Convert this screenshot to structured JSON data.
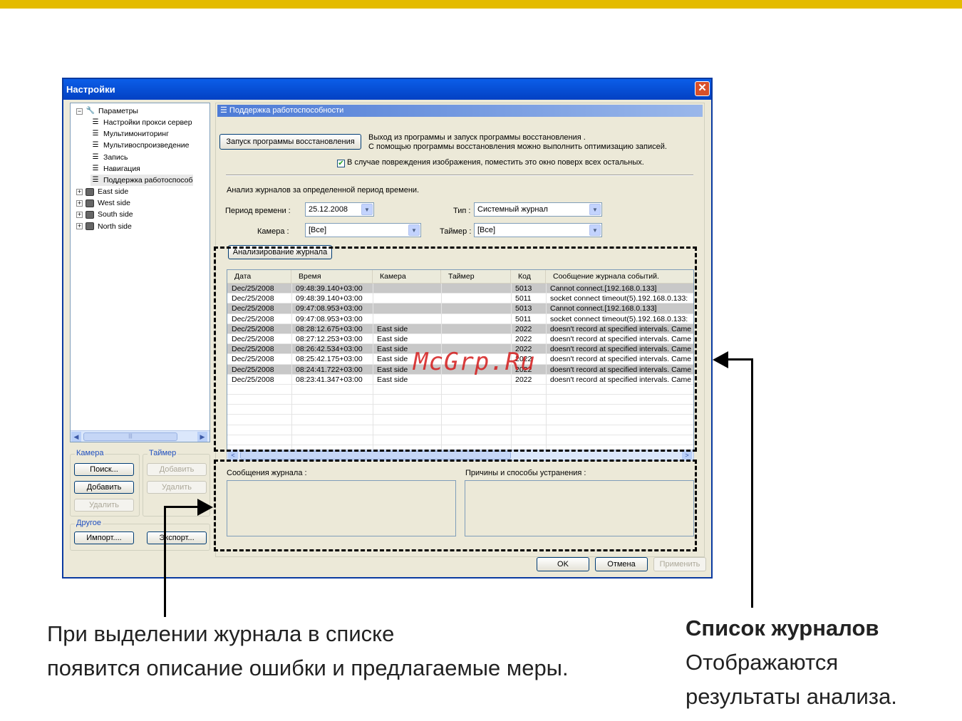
{
  "window": {
    "title": "Настройки",
    "close_glyph": "✕"
  },
  "tree": {
    "root": "Параметры",
    "children": [
      "Настройки прокси сервер",
      "Мультимониторинг",
      "Мультивоспроизведение",
      "Запись",
      "Навигация",
      "Поддержка работоспособ"
    ],
    "groups": [
      "East side",
      "West side",
      "South side",
      "North side"
    ],
    "expanded_glyph": "−",
    "collapsed_glyph": "+",
    "scroll_center": "|||"
  },
  "left_groups": {
    "camera": {
      "label": "Камера",
      "search": "Поиск...",
      "add": "Добавить",
      "remove": "Удалить"
    },
    "timer": {
      "label": "Таймер",
      "add": "Добавить",
      "remove": "Удалить"
    },
    "other": {
      "label": "Другое",
      "import": "Импорт....",
      "export": "Экспорт..."
    }
  },
  "panel": {
    "title": "Поддержка работоспособности",
    "restore_button": "Запуск программы восстановления",
    "restore_desc1": "Выход из программы и запуск программы восстановления .",
    "restore_desc2": "С помощью программы восстановления можно выполнить оптимизацию записей.",
    "on_top_checkbox": "В случае повреждения изображения, поместить это окно поверх всех остальных.",
    "on_top_checked": true,
    "analysis_caption": "Анализ журналов за определенной период времени.",
    "period_label": "Период времени :",
    "period_value": "25.12.2008",
    "type_label": "Тип :",
    "type_value": "Системный журнал",
    "camera_label": "Камера :",
    "camera_value": "[Все]",
    "timer_label": "Таймер :",
    "timer_value": "[Все]",
    "analyze_button": "Анализирование журнала",
    "log_messages_label": "Сообщения журнала :",
    "causes_label": "Причины и способы устранения :"
  },
  "log_table": {
    "columns": [
      "Дата",
      "Время",
      "Камера",
      "Таймер",
      "Код",
      "Сообщение журнала событий."
    ],
    "rows": [
      [
        "Dec/25/2008",
        "09:48:39.140+03:00",
        "",
        "",
        "5013",
        "Cannot connect.[192.168.0.133]"
      ],
      [
        "Dec/25/2008",
        "09:48:39.140+03:00",
        "",
        "",
        "5011",
        "socket connect timeout(5).192.168.0.133:"
      ],
      [
        "Dec/25/2008",
        "09:47:08.953+03:00",
        "",
        "",
        "5013",
        "Cannot connect.[192.168.0.133]"
      ],
      [
        "Dec/25/2008",
        "09:47:08.953+03:00",
        "",
        "",
        "5011",
        "socket connect timeout(5).192.168.0.133:"
      ],
      [
        "Dec/25/2008",
        "08:28:12.675+03:00",
        "East side",
        "",
        "2022",
        "doesn't record at specified intervals. Came"
      ],
      [
        "Dec/25/2008",
        "08:27:12.253+03:00",
        "East side",
        "",
        "2022",
        "doesn't record at specified intervals. Came"
      ],
      [
        "Dec/25/2008",
        "08:26:42.534+03:00",
        "East side",
        "",
        "2022",
        "doesn't record at specified intervals. Came"
      ],
      [
        "Dec/25/2008",
        "08:25:42.175+03:00",
        "East side",
        "",
        "2022",
        "doesn't record at specified intervals. Came"
      ],
      [
        "Dec/25/2008",
        "08:24:41.722+03:00",
        "East side",
        "",
        "2022",
        "doesn't record at specified intervals. Came"
      ],
      [
        "Dec/25/2008",
        "08:23:41.347+03:00",
        "East side",
        "",
        "2022",
        "doesn't record at specified intervals. Came"
      ]
    ],
    "scroll_left": "<",
    "scroll_right": ">"
  },
  "footer": {
    "ok": "OK",
    "cancel": "Отмена",
    "apply": "Применить"
  },
  "watermark": "McGrp.Ru",
  "annotations": {
    "left_line1": "При выделении журнала в списке",
    "left_line2": "появится описание ошибки и предлагаемые меры.",
    "right_title": "Список журналов",
    "right_line1": "Отображаются",
    "right_line2": "результаты анализа."
  },
  "colors": {
    "accent_bar": "#e4bb00",
    "title_blue": "#0b5ee8",
    "watermark": "#d41c1c"
  }
}
